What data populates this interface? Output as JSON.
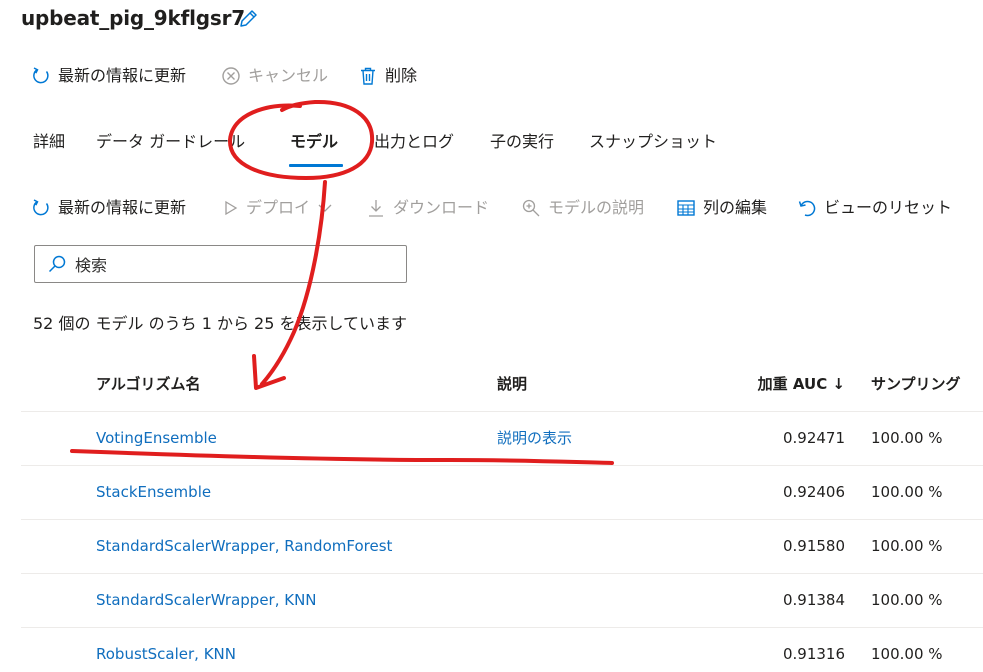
{
  "run_title": "upbeat_pig_9kflgsr7",
  "top_toolbar": {
    "refresh_label": "最新の情報に更新",
    "cancel_label": "キャンセル",
    "delete_label": "削除"
  },
  "tabs": [
    "詳細",
    "データ ガードレール",
    "モデル",
    "出力とログ",
    "子の実行",
    "スナップショット"
  ],
  "active_tab": "モデル",
  "model_toolbar": {
    "refresh_label": "最新の情報に更新",
    "deploy_label": "デプロイ",
    "download_label": "ダウンロード",
    "explain_label": "モデルの説明",
    "edit_columns_label": "列の編集",
    "reset_view_label": "ビューのリセット"
  },
  "search": {
    "placeholder": "検索"
  },
  "result_count": "52 個の モデル のうち 1 から 25 を表示しています",
  "table": {
    "headers": {
      "algorithm": "アルゴリズム名",
      "explanation": "説明",
      "auc": "加重 AUC ↓",
      "sampling": "サンプリング"
    },
    "rows": [
      {
        "algorithm": "VotingEnsemble",
        "explanation": "説明の表示",
        "auc": "0.92471",
        "sampling": "100.00 %"
      },
      {
        "algorithm": "StackEnsemble",
        "explanation": "",
        "auc": "0.92406",
        "sampling": "100.00 %"
      },
      {
        "algorithm": "StandardScalerWrapper, RandomForest",
        "explanation": "",
        "auc": "0.91580",
        "sampling": "100.00 %"
      },
      {
        "algorithm": "StandardScalerWrapper, KNN",
        "explanation": "",
        "auc": "0.91384",
        "sampling": "100.00 %"
      },
      {
        "algorithm": "RobustScaler, KNN",
        "explanation": "",
        "auc": "0.91316",
        "sampling": "100.00 %"
      }
    ]
  },
  "colors": {
    "accent": "#0078d4",
    "link": "#106ebe",
    "annotation": "#e01e1e",
    "disabled": "#a19f9d"
  }
}
